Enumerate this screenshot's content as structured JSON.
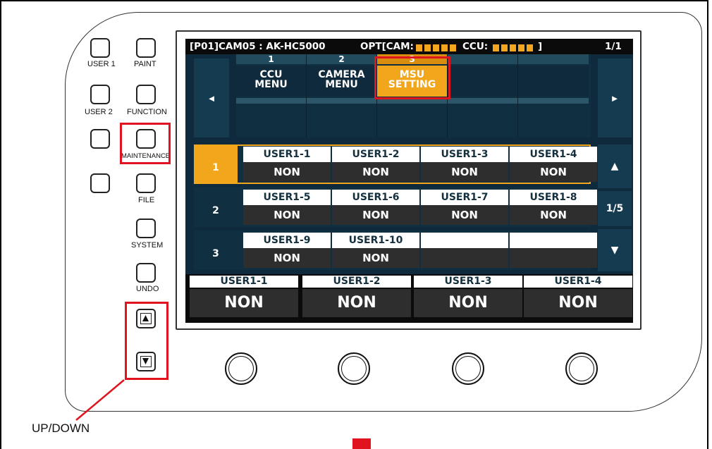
{
  "hardware_buttons": {
    "user1": "USER 1",
    "paint": "PAINT",
    "user2": "USER 2",
    "function": "FUNCTION",
    "maintenance": "MAINTENANCE",
    "file": "FILE",
    "system": "SYSTEM",
    "undo": "UNDO"
  },
  "header": {
    "title": "[P01]CAM05 : AK-HC5000",
    "opt_cam": "OPT[CAM:",
    "ccu": "CCU:",
    "bracket": "]",
    "page": "1/1"
  },
  "nav": {
    "left": "◄",
    "right": "►"
  },
  "tabs": [
    {
      "num": "1",
      "line1": "CCU",
      "line2": "MENU",
      "selected": false
    },
    {
      "num": "2",
      "line1": "CAMERA",
      "line2": "MENU",
      "selected": false
    },
    {
      "num": "3",
      "line1": "MSU",
      "line2": "SETTING",
      "selected": true
    },
    {
      "num": "",
      "line1": "",
      "line2": "",
      "selected": false
    },
    {
      "num": "",
      "line1": "",
      "line2": "",
      "selected": false
    }
  ],
  "rows": [
    {
      "index": "1",
      "selected": true,
      "cells": [
        {
          "label": "USER1-1",
          "value": "NON"
        },
        {
          "label": "USER1-2",
          "value": "NON"
        },
        {
          "label": "USER1-3",
          "value": "NON"
        },
        {
          "label": "USER1-4",
          "value": "NON"
        }
      ]
    },
    {
      "index": "2",
      "selected": false,
      "cells": [
        {
          "label": "USER1-5",
          "value": "NON"
        },
        {
          "label": "USER1-6",
          "value": "NON"
        },
        {
          "label": "USER1-7",
          "value": "NON"
        },
        {
          "label": "USER1-8",
          "value": "NON"
        }
      ]
    },
    {
      "index": "3",
      "selected": false,
      "cells": [
        {
          "label": "USER1-9",
          "value": "NON"
        },
        {
          "label": "USER1-10",
          "value": "NON"
        },
        {
          "label": "",
          "value": ""
        },
        {
          "label": "",
          "value": ""
        }
      ]
    }
  ],
  "scroll": {
    "up": "▲",
    "page": "1/5",
    "down": "▼"
  },
  "bottom_bar": [
    {
      "label": "USER1-1",
      "value": "NON"
    },
    {
      "label": "USER1-2",
      "value": "NON"
    },
    {
      "label": "USER1-3",
      "value": "NON"
    },
    {
      "label": "USER1-4",
      "value": "NON"
    }
  ],
  "callout": "UP/DOWN",
  "colors": {
    "highlight": "#e0141e",
    "accent": "#f1a61c",
    "screen_bg": "#0e2a3c"
  }
}
